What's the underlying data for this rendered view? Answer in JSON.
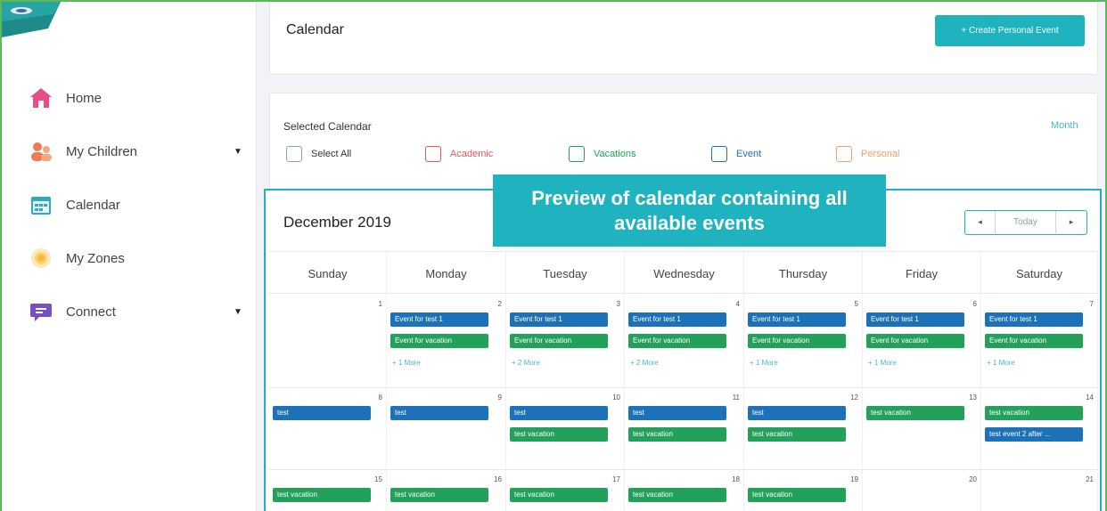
{
  "sidebar": {
    "items": [
      {
        "label": "Home",
        "icon": "home-icon",
        "color": "#e84c8a",
        "caret": false
      },
      {
        "label": "My Children",
        "icon": "children-icon",
        "color": "#f07a55",
        "caret": true
      },
      {
        "label": "Calendar",
        "icon": "calendar-icon",
        "color": "#2aa9c9",
        "caret": false
      },
      {
        "label": "My Zones",
        "icon": "zones-icon",
        "color": "#f6b93b",
        "caret": false
      },
      {
        "label": "Connect",
        "icon": "connect-icon",
        "color": "#7b4fc4",
        "caret": true
      }
    ]
  },
  "header": {
    "title": "Calendar",
    "create_label": "+ Create Personal Event"
  },
  "filters": {
    "label": "Selected Calendar",
    "view_label": "Month",
    "options": [
      {
        "label": "Select All",
        "color": "#333333",
        "border": "#8aa3b8"
      },
      {
        "label": "Academic",
        "color": "#e05a5a",
        "border": "#e05a5a"
      },
      {
        "label": "Vacations",
        "color": "#23a05a",
        "border": "#23a05a"
      },
      {
        "label": "Event",
        "color": "#1c71b8",
        "border": "#1c71b8"
      },
      {
        "label": "Personal",
        "color": "#f0a066",
        "border": "#f0a066"
      }
    ]
  },
  "calendar": {
    "title": "December 2019",
    "prev_label": "◂",
    "today_label": "Today",
    "next_label": "▸",
    "days_of_week": [
      "Sunday",
      "Monday",
      "Tuesday",
      "Wednesday",
      "Thursday",
      "Friday",
      "Saturday"
    ],
    "weeks": [
      [
        {
          "day": "1",
          "events": [],
          "more": ""
        },
        {
          "day": "2",
          "events": [
            {
              "label": "Event for test 1",
              "color": "blue"
            },
            {
              "label": "Event for vacation",
              "color": "green"
            }
          ],
          "more": "+ 1 More"
        },
        {
          "day": "3",
          "events": [
            {
              "label": "Event for test 1",
              "color": "blue"
            },
            {
              "label": "Event for vacation",
              "color": "green"
            }
          ],
          "more": "+ 2 More"
        },
        {
          "day": "4",
          "events": [
            {
              "label": "Event for test 1",
              "color": "blue"
            },
            {
              "label": "Event for vacation",
              "color": "green"
            }
          ],
          "more": "+ 2 More"
        },
        {
          "day": "5",
          "events": [
            {
              "label": "Event for test 1",
              "color": "blue"
            },
            {
              "label": "Event for vacation",
              "color": "green"
            }
          ],
          "more": "+ 1 More"
        },
        {
          "day": "6",
          "events": [
            {
              "label": "Event for test 1",
              "color": "blue"
            },
            {
              "label": "Event for vacation",
              "color": "green"
            }
          ],
          "more": "+ 1 More"
        },
        {
          "day": "7",
          "events": [
            {
              "label": "Event for test 1",
              "color": "blue"
            },
            {
              "label": "Event for vacation",
              "color": "green"
            }
          ],
          "more": "+ 1 More"
        }
      ],
      [
        {
          "day": "8",
          "events": [
            {
              "label": "test",
              "color": "blue"
            }
          ],
          "more": ""
        },
        {
          "day": "9",
          "events": [
            {
              "label": "test",
              "color": "blue"
            }
          ],
          "more": ""
        },
        {
          "day": "10",
          "events": [
            {
              "label": "test",
              "color": "blue"
            },
            {
              "label": "test vacation",
              "color": "green"
            }
          ],
          "more": ""
        },
        {
          "day": "11",
          "events": [
            {
              "label": "test",
              "color": "blue"
            },
            {
              "label": "test vacation",
              "color": "green"
            }
          ],
          "more": ""
        },
        {
          "day": "12",
          "events": [
            {
              "label": "test",
              "color": "blue"
            },
            {
              "label": "test vacation",
              "color": "green"
            }
          ],
          "more": ""
        },
        {
          "day": "13",
          "events": [
            {
              "label": "test vacation",
              "color": "green"
            }
          ],
          "more": ""
        },
        {
          "day": "14",
          "events": [
            {
              "label": "test vacation",
              "color": "green"
            },
            {
              "label": "test event 2 after ...",
              "color": "blue"
            }
          ],
          "more": ""
        }
      ],
      [
        {
          "day": "15",
          "events": [
            {
              "label": "test vacation",
              "color": "green"
            }
          ],
          "more": ""
        },
        {
          "day": "16",
          "events": [
            {
              "label": "test vacation",
              "color": "green"
            }
          ],
          "more": ""
        },
        {
          "day": "17",
          "events": [
            {
              "label": "test vacation",
              "color": "green"
            }
          ],
          "more": ""
        },
        {
          "day": "18",
          "events": [
            {
              "label": "test vacation",
              "color": "green"
            }
          ],
          "more": ""
        },
        {
          "day": "19",
          "events": [
            {
              "label": "test vacation",
              "color": "green"
            }
          ],
          "more": ""
        },
        {
          "day": "20",
          "events": [],
          "more": ""
        },
        {
          "day": "21",
          "events": [],
          "more": ""
        }
      ]
    ]
  },
  "callout": {
    "text": "Preview of calendar containing all available events"
  },
  "colors": {
    "accent": "#1fb3c0",
    "event_blue": "#1c71b8",
    "event_green": "#23a05a",
    "frame_green": "#5bb85c"
  }
}
